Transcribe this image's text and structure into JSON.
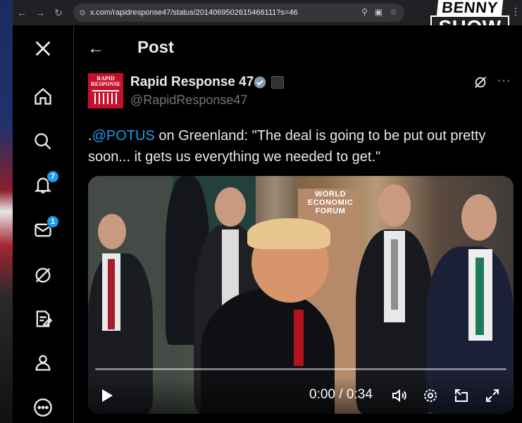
{
  "browser": {
    "url": "x.com/rapidresponse47/status/2014069502615466111?s=46",
    "back_icon": "arrow-left-icon",
    "forward_icon": "arrow-right-icon",
    "reload_icon": "reload-icon"
  },
  "overlay_logo": {
    "line1": "BENNY",
    "line2": "SHOW"
  },
  "sidebar": {
    "items": [
      {
        "name": "x-logo-icon"
      },
      {
        "name": "home-icon"
      },
      {
        "name": "search-icon"
      },
      {
        "name": "notifications-icon",
        "badge": "7"
      },
      {
        "name": "messages-icon",
        "badge": "1"
      },
      {
        "name": "grok-icon"
      },
      {
        "name": "compose-icon"
      },
      {
        "name": "profile-icon"
      },
      {
        "name": "more-icon"
      }
    ]
  },
  "header": {
    "title": "Post"
  },
  "post": {
    "author_name": "Rapid Response 47",
    "author_handle": "@RapidResponse47",
    "avatar_text": "RAPID RESPONSE",
    "text_prefix": ".",
    "mention": "@POTUS",
    "text_body": " on Greenland: \"The deal is going to be put out pretty soon... it gets us everything we needed to get.\"",
    "video_overlay_text": "WORLD ECONOMIC FORUM",
    "video_time": "0:00 / 0:34"
  },
  "colors": {
    "accent": "#1d9bf0",
    "background": "#000000",
    "text": "#e7e9ea",
    "muted": "#71767b",
    "avatar_red": "#c8102e"
  }
}
